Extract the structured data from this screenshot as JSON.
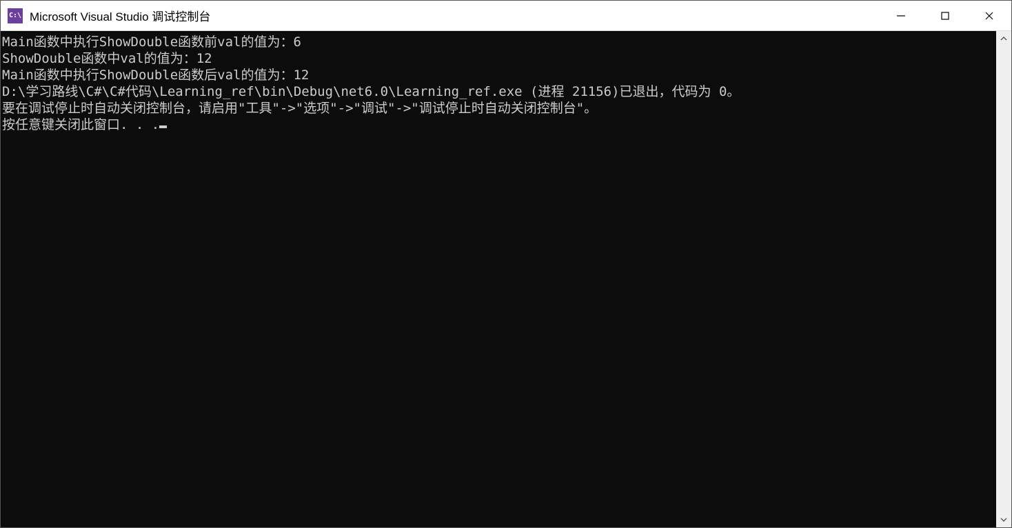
{
  "window": {
    "title": "Microsoft Visual Studio 调试控制台",
    "icon_label": "C:\\"
  },
  "console": {
    "lines": [
      "Main函数中执行ShowDouble函数前val的值为：6",
      "ShowDouble函数中val的值为：12",
      "Main函数中执行ShowDouble函数后val的值为：12",
      "",
      "D:\\学习路线\\C#\\C#代码\\Learning_ref\\bin\\Debug\\net6.0\\Learning_ref.exe (进程 21156)已退出，代码为 0。",
      "要在调试停止时自动关闭控制台，请启用\"工具\"->\"选项\"->\"调试\"->\"调试停止时自动关闭控制台\"。",
      "按任意键关闭此窗口. . ."
    ]
  }
}
